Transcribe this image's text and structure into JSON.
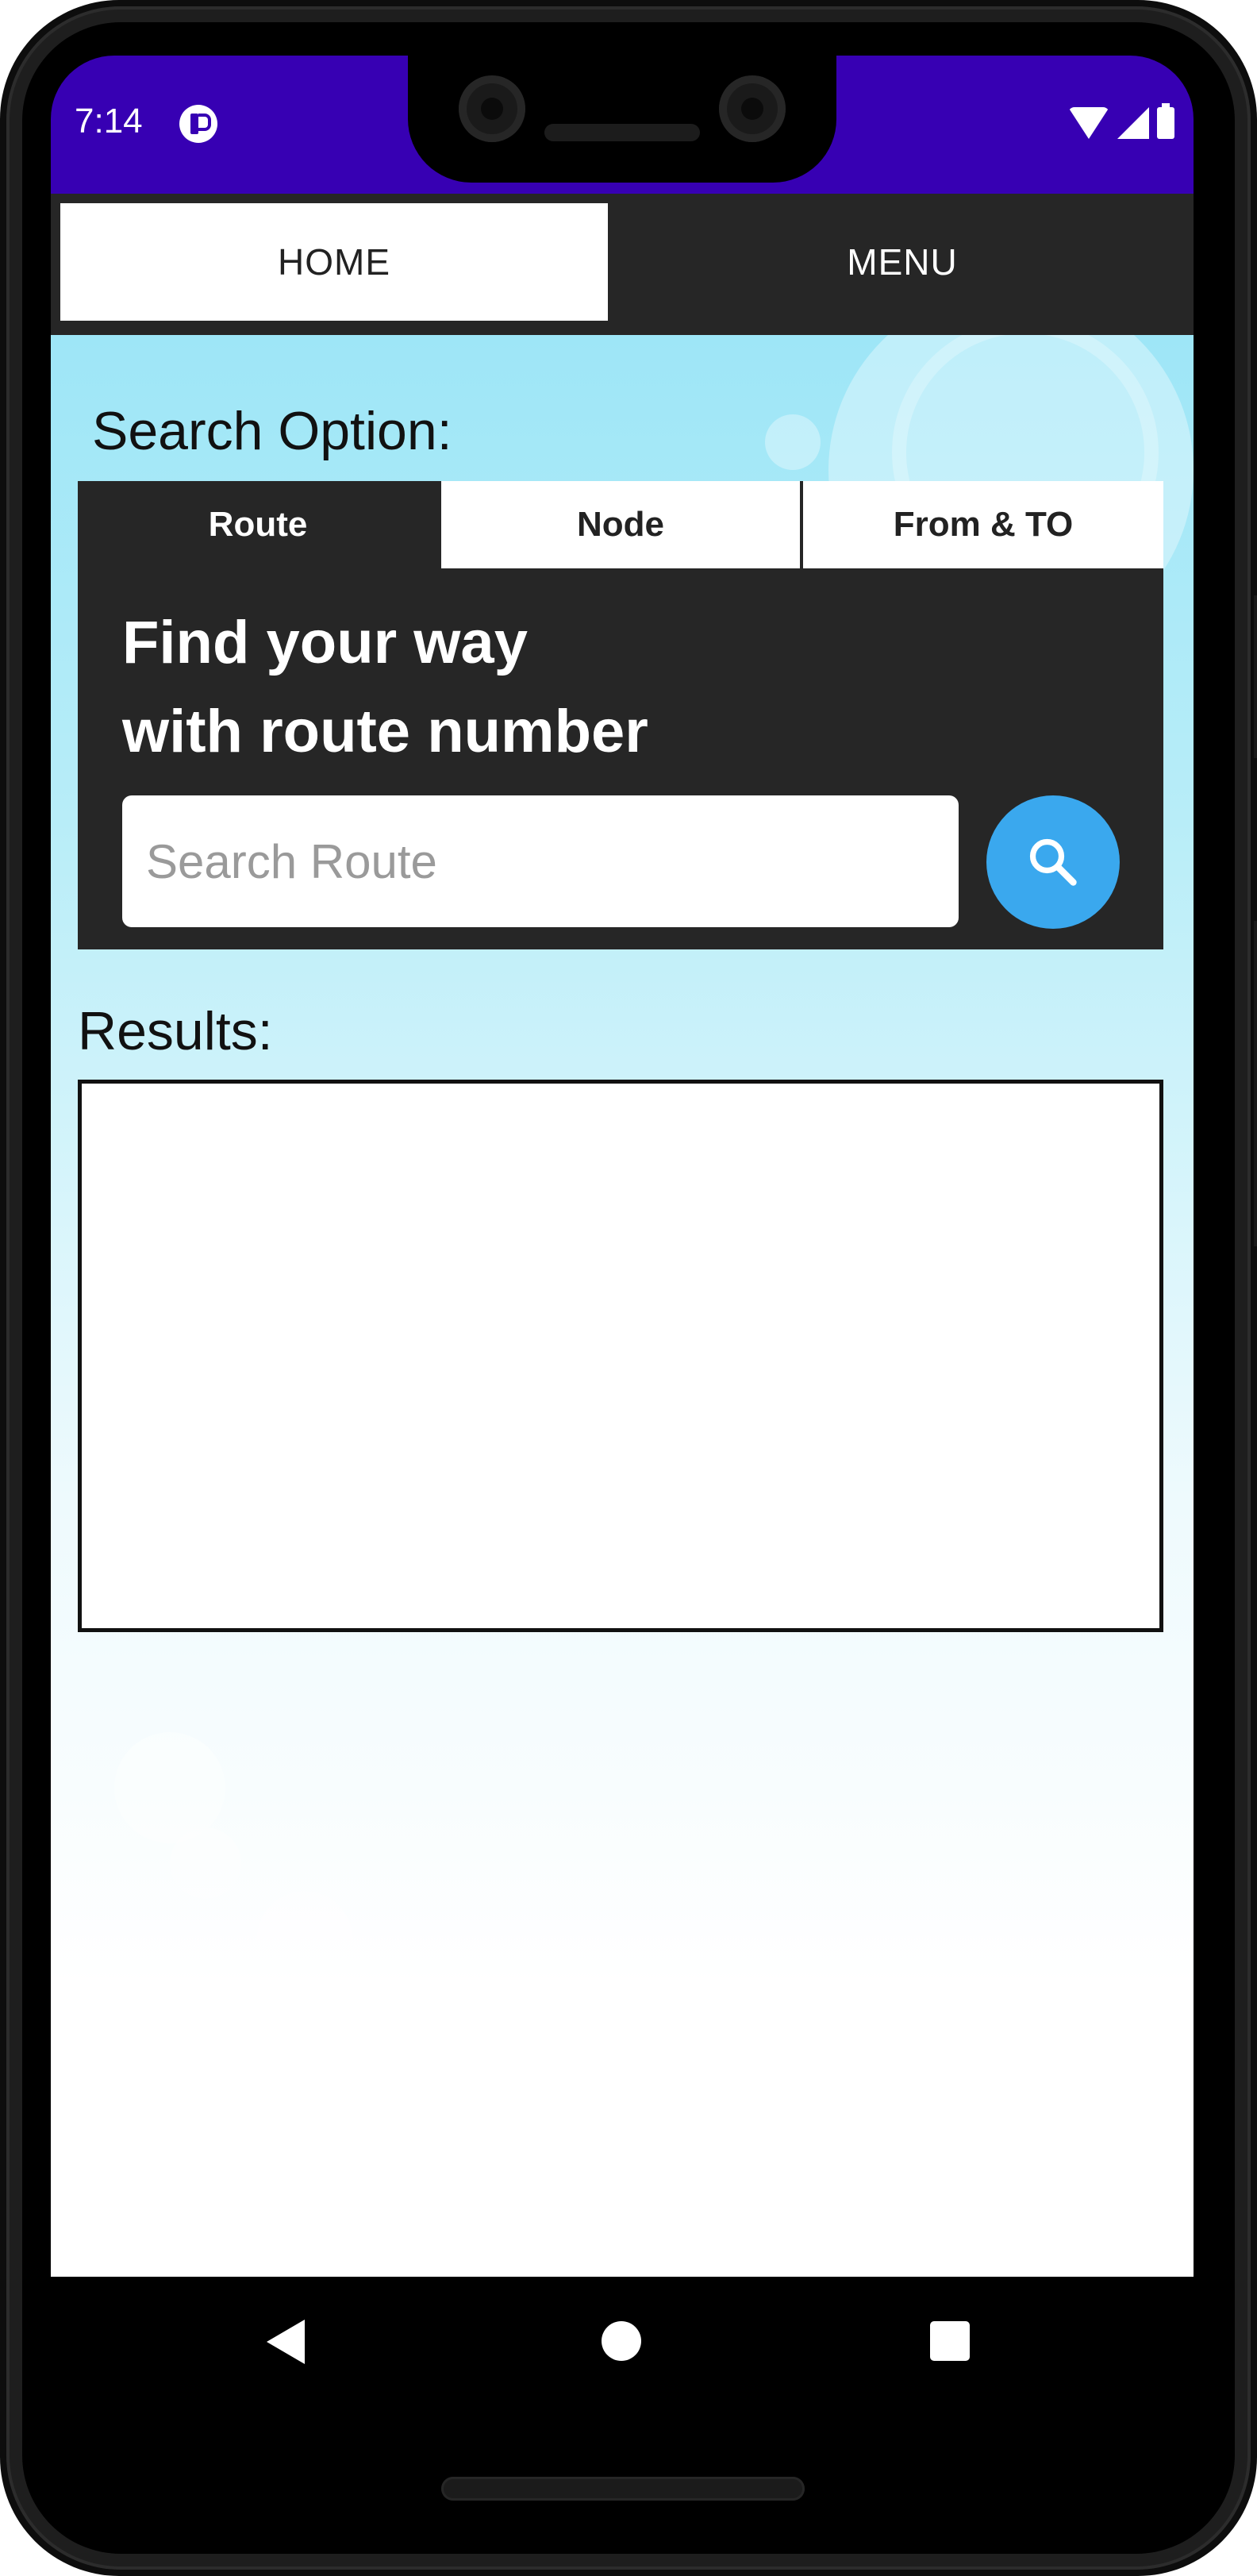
{
  "status_bar": {
    "time": "7:14",
    "icons": [
      "app-notification-icon",
      "wifi-icon",
      "cellular-signal-icon",
      "battery-icon"
    ],
    "background_color": "#3700b3"
  },
  "top_tabs": {
    "home_label": "HOME",
    "menu_label": "MENU",
    "selected": "HOME"
  },
  "search": {
    "heading": "Search Option:",
    "tabs": [
      "Route",
      "Node",
      "From & TO"
    ],
    "selected_tab": "Route",
    "title_line1": "Find your way",
    "title_line2": "with route number",
    "input_value": "",
    "input_placeholder": "Search Route",
    "button_icon": "search-icon",
    "button_color": "#3aa8ee"
  },
  "results": {
    "label": "Results:",
    "items": []
  },
  "nav_bar": {
    "icons": [
      "back-icon",
      "home-icon",
      "recents-icon"
    ]
  },
  "colors": {
    "panel": "#262626",
    "accent": "#3aa8ee",
    "status_bar": "#3700b3"
  }
}
